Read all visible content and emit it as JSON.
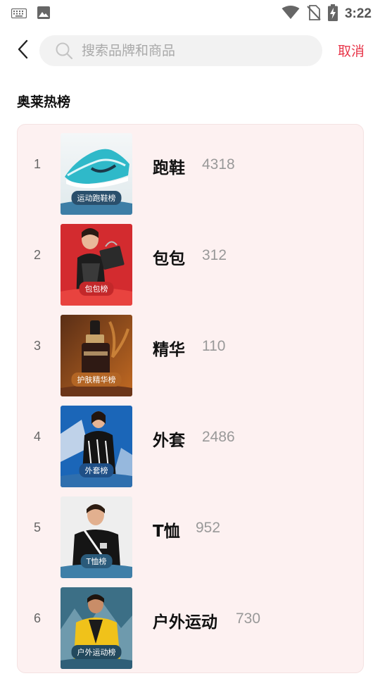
{
  "status_bar": {
    "time": "3:22",
    "left_icons": [
      "keyboard-icon",
      "image-icon"
    ],
    "right_icons": [
      "wifi-icon",
      "no-sim-icon",
      "battery-charging-icon"
    ]
  },
  "header": {
    "back_icon": "chevron-left-icon",
    "search_placeholder": "搜索品牌和商品",
    "search_value": "",
    "cancel_label": "取消"
  },
  "section": {
    "title": "奥莱热榜"
  },
  "colors": {
    "accent": "#e8364a",
    "card_bg": "#fdf1f1"
  },
  "rankings": [
    {
      "rank": "1",
      "name": "跑鞋",
      "count": "4318",
      "tag": "运动跑鞋榜",
      "thumb": "running-shoe-image"
    },
    {
      "rank": "2",
      "name": "包包",
      "count": "312",
      "tag": "包包榜",
      "thumb": "handbag-model-image"
    },
    {
      "rank": "3",
      "name": "精华",
      "count": "110",
      "tag": "护肤精华榜",
      "thumb": "serum-bottle-image"
    },
    {
      "rank": "4",
      "name": "外套",
      "count": "2486",
      "tag": "外套榜",
      "thumb": "jacket-model-image"
    },
    {
      "rank": "5",
      "name": "T恤",
      "count": "952",
      "tag": "T恤榜",
      "thumb": "tshirt-model-image"
    },
    {
      "rank": "6",
      "name": "户外运动",
      "count": "730",
      "tag": "户外运动榜",
      "thumb": "outdoor-model-image"
    }
  ]
}
